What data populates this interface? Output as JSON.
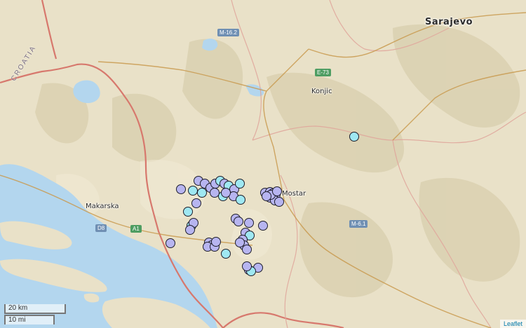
{
  "places": {
    "sarajevo": "Sarajevo",
    "konjic": "Konjic",
    "mostar": "Mostar",
    "makarska": "Makarska",
    "croatia": "CROATIA"
  },
  "roads": {
    "m162": "M-16.2",
    "e73": "E-73",
    "m61": "M-6.1",
    "a1": "A1",
    "d8": "D8"
  },
  "scale": {
    "km": "20 km",
    "mi": "10 mi"
  },
  "attribution": "Leaflet",
  "colors": {
    "land": "#e9e1c8",
    "water": "#b3d6ee",
    "border": "#d7786d",
    "road": "#c99a4f",
    "marker_lavender": "#b7b5f0",
    "marker_cyan": "#9fe8f2"
  },
  "marker_count": 70
}
